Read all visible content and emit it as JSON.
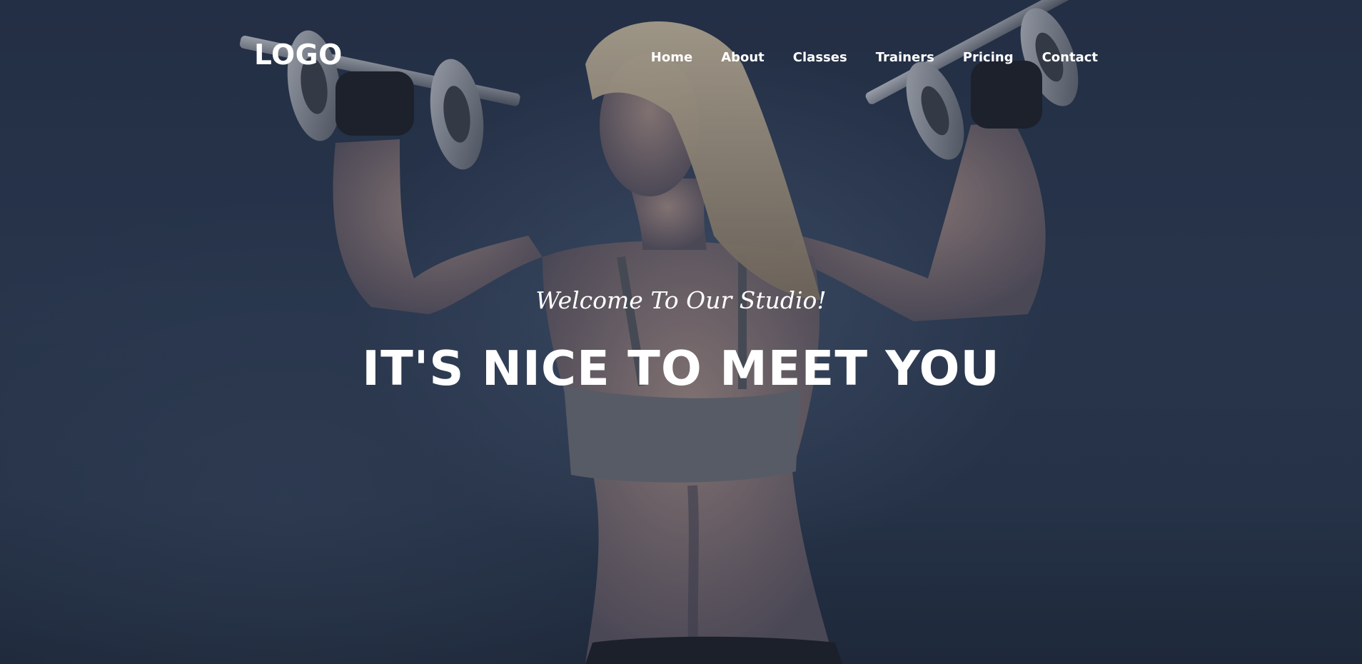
{
  "logo": "LOGO",
  "nav": {
    "items": [
      {
        "label": "Home"
      },
      {
        "label": "About"
      },
      {
        "label": "Classes"
      },
      {
        "label": "Trainers"
      },
      {
        "label": "Pricing"
      },
      {
        "label": "Contact"
      }
    ]
  },
  "hero": {
    "subheading": "Welcome To Our Studio!",
    "heading": "IT'S NICE TO MEET YOU",
    "background_image": "woman-lifting-dumbbells-photo"
  },
  "colors": {
    "overlay": "#1e2838",
    "text": "#ffffff"
  }
}
